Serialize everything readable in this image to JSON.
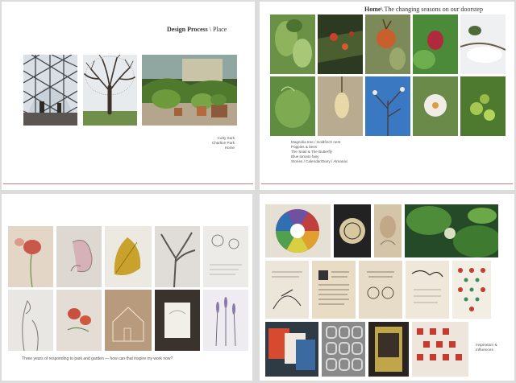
{
  "panel1": {
    "title_bold": "Design Process",
    "title_rest": " \\ Place",
    "captions": [
      "Cutty Sark",
      "Charlton Park",
      "Home"
    ]
  },
  "panel2": {
    "title_bold": "Home\\",
    "title_rest": " The changing seasons on our doorstep",
    "captions": [
      "Magnolia tree / Goldfinch nest",
      "Poppies & bees",
      "The Snail & The Butterfly",
      "Blue tomato fairy",
      "Stories / Calendar/Diary / Almanac"
    ]
  },
  "panel3": {
    "caption": "Three years of responding to park and garden — how can that inspire my work now?"
  },
  "panel4": {
    "caption_lines": [
      "Inspiration &",
      "Influences"
    ]
  },
  "colors": {
    "rule": "#c67c78",
    "page_bg": "#ffffff",
    "canvas_bg": "#dcdcdc"
  }
}
